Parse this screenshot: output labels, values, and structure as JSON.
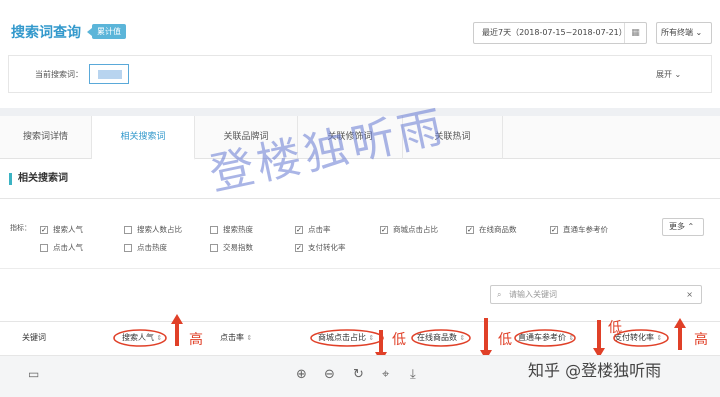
{
  "window": {
    "minimize": "–",
    "maximize": "☐",
    "close": "✕"
  },
  "header": {
    "title": "搜索词查询",
    "badge": "累计值",
    "date_range": "最近7天（2018-07-15~2018-07-21）",
    "terminal": "所有终端",
    "current_label": "当前搜索词：",
    "expand": "展开"
  },
  "tabs": [
    "搜索词详情",
    "相关搜索词",
    "关联品牌词",
    "关联修饰词",
    "关联热词"
  ],
  "active_tab": 1,
  "section": {
    "title": "相关搜索词"
  },
  "filters": {
    "label": "指标：",
    "options": [
      {
        "label": "搜索人气",
        "checked": true
      },
      {
        "label": "搜索人数占比",
        "checked": false
      },
      {
        "label": "搜索热度",
        "checked": false
      },
      {
        "label": "点击率",
        "checked": true
      },
      {
        "label": "商城点击占比",
        "checked": true
      },
      {
        "label": "在线商品数",
        "checked": true
      },
      {
        "label": "直通车参考价",
        "checked": true
      },
      {
        "label": "点击人气",
        "checked": false
      },
      {
        "label": "点击热度",
        "checked": false
      },
      {
        "label": "交易指数",
        "checked": false
      },
      {
        "label": "支付转化率",
        "checked": true
      }
    ],
    "more": "更多"
  },
  "search": {
    "placeholder": "请输入关键词",
    "clear": "×"
  },
  "table": {
    "headers": [
      "关键词",
      "搜索人气",
      "点击率",
      "商城点击占比",
      "在线商品数",
      "直通车参考价",
      "支付转化率"
    ]
  },
  "annotations": {
    "high": "高",
    "low": "低",
    "watermark": "登楼独听雨",
    "credit": "知乎 @登楼独听雨",
    "color": "#e04028"
  }
}
